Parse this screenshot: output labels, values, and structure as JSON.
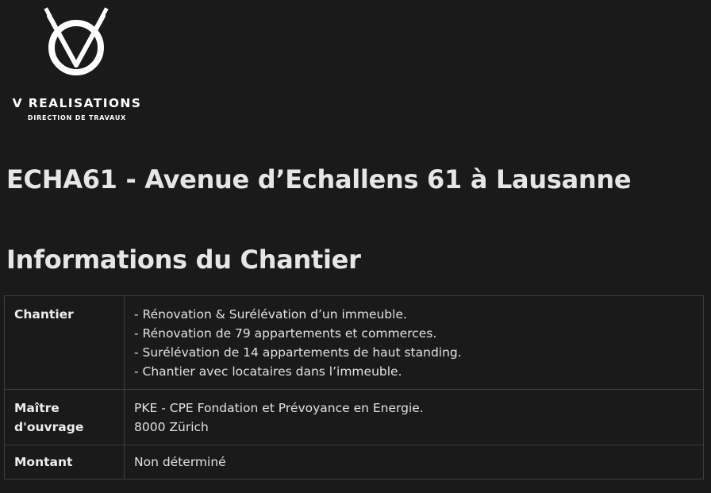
{
  "logo": {
    "title": "V REALISATIONS",
    "subtitle": "DIRECTION DE TRAVAUX",
    "icon": "v-compass-logo"
  },
  "page_title": "ECHA61 - Avenue d’Echallens 61 à Lausanne",
  "section_title": "Informations du Chantier",
  "info_table": {
    "rows": [
      {
        "label": "Chantier",
        "lines": [
          "- Rénovation & Surélévation d’un immeuble.",
          "- Rénovation de 79 appartements et commerces.",
          "- Surélévation de 14 appartements de haut standing.",
          "- Chantier avec locataires dans l’immeuble."
        ]
      },
      {
        "label_lines": [
          "Maître",
          "d'ouvrage"
        ],
        "lines": [
          "PKE - CPE Fondation et Prévoyance en Energie.",
          "8000 Zürich"
        ]
      },
      {
        "label": "Montant",
        "lines": [
          "Non déterminé"
        ]
      }
    ]
  },
  "colors": {
    "background": "#1a1a1a",
    "text": "#e6e6e6",
    "border": "#3d3d3d",
    "logo": "#ffffff"
  }
}
